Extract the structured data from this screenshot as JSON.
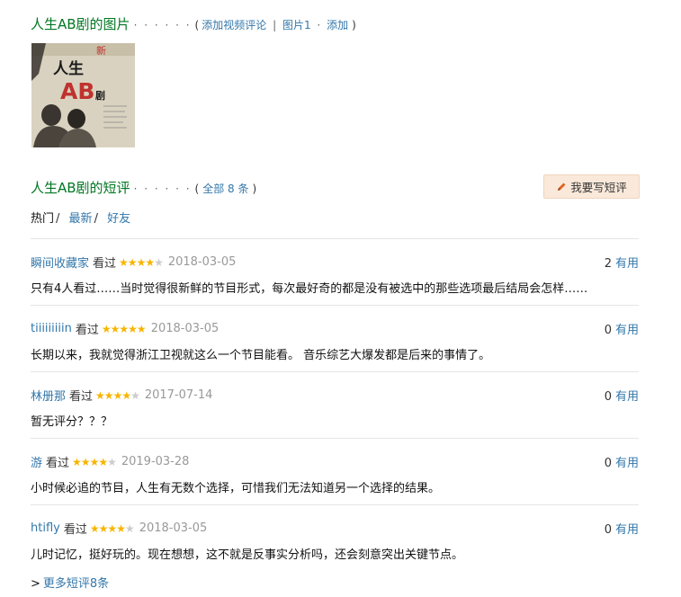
{
  "photos_section": {
    "title": "人生AB剧的图片",
    "dots": "· · · · · ·",
    "paren_open": "(",
    "add_video_review": "添加视频评论",
    "pipe": "|",
    "photos_count": "图片1",
    "dot_sep": "·",
    "add": "添加",
    "paren_close": ")"
  },
  "poster": {
    "title_top": "人生",
    "title_ab": "AB",
    "title_drama": "剧",
    "tag": "新",
    "colors": {
      "bg": "#d9d2c0",
      "title": "#1a1a1a",
      "ab": "#c0322e"
    }
  },
  "reviews_section": {
    "title": "人生AB剧的短评",
    "dots": "· · · · · ·",
    "paren_open": "(",
    "all_link": "全部 8 条",
    "paren_close": ")",
    "write_button": "我要写短评",
    "write_icon": "pencil-icon"
  },
  "tabs": [
    {
      "label": "热门",
      "active": true
    },
    {
      "label": "最新",
      "active": false
    },
    {
      "label": "好友",
      "active": false
    }
  ],
  "tab_slash": "/",
  "reviews": [
    {
      "user": "瞬间收藏家",
      "status": "看过",
      "rating": 4,
      "date": "2018-03-05",
      "useful_count": "2",
      "useful_label": "有用",
      "text": "只有4人看过……当时觉得很新鲜的节目形式，每次最好奇的都是没有被选中的那些选项最后结局会怎样……"
    },
    {
      "user": "tiiiiiiiiin",
      "status": "看过",
      "rating": 5,
      "date": "2018-03-05",
      "useful_count": "0",
      "useful_label": "有用",
      "text": "长期以来，我就觉得浙江卫视就这么一个节目能看。 音乐综艺大爆发都是后来的事情了。"
    },
    {
      "user": "林册那",
      "status": "看过",
      "rating": 4,
      "date": "2017-07-14",
      "useful_count": "0",
      "useful_label": "有用",
      "text": "暂无评分？？？"
    },
    {
      "user": "游",
      "status": "看过",
      "rating": 4,
      "date": "2019-03-28",
      "useful_count": "0",
      "useful_label": "有用",
      "text": "小时候必追的节目，人生有无数个选择，可惜我们无法知道另一个选择的结果。"
    },
    {
      "user": "htifly",
      "status": "看过",
      "rating": 4,
      "date": "2018-03-05",
      "useful_count": "0",
      "useful_label": "有用",
      "text": "儿时记忆，挺好玩的。现在想想，这不就是反事实分析吗，还会刻意突出关键节点。"
    }
  ],
  "more": {
    "arrow": ">",
    "label": "更多短评8条"
  },
  "colors": {
    "title_green": "#007722",
    "link_blue": "#3377aa",
    "star": "#f7b500",
    "star_empty": "#cccccc",
    "button_bg": "#fae9da",
    "pencil": "#e0621f"
  }
}
